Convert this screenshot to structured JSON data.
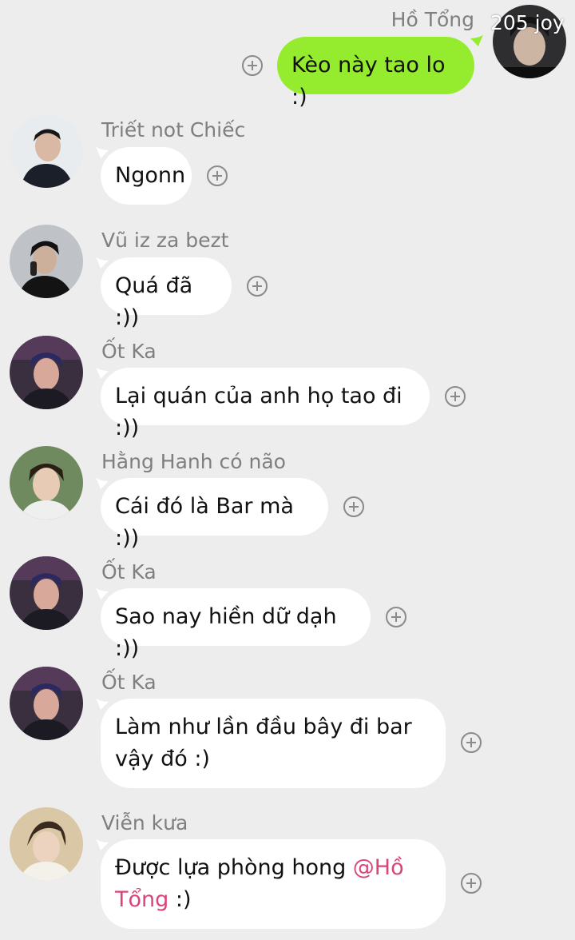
{
  "watermark": "205 joy",
  "colors": {
    "own_bubble": "#95ec2f",
    "other_bubble": "#ffffff",
    "background": "#ededed",
    "mention": "#d9447a"
  },
  "messages": [
    {
      "sender": "Hồ Tổng",
      "own": true,
      "text": "Kèo này tao lo :)"
    },
    {
      "sender": "Triết not Chiếc",
      "text": "Ngonn"
    },
    {
      "sender": "Vũ iz za bezt",
      "text": "Quá đã :))"
    },
    {
      "sender": "Ốt Ka",
      "text": "Lại quán của anh họ tao đi :))"
    },
    {
      "sender": "Hằng Hanh có não",
      "text": "Cái đó là Bar mà :))"
    },
    {
      "sender": "Ốt Ka",
      "text": "Sao nay hiền dữ dạh :))"
    },
    {
      "sender": "Ốt Ka",
      "text_line1": "Làm như lần đầu bây đi bar",
      "text_line2": "vậy đó :)"
    },
    {
      "sender": "Viễn kưa",
      "text_before": "Được lựa phòng hong ",
      "mention_line1": "@Hồ",
      "mention_line2": "Tổng",
      "text_after": " :)"
    }
  ]
}
